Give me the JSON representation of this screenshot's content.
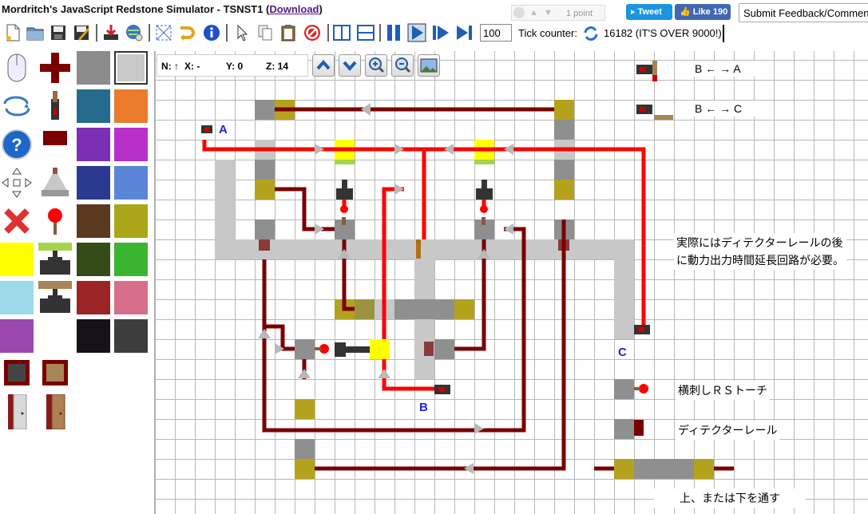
{
  "app": {
    "title_prefix": "Mordritch's JavaScript Redstone Simulator - TSNST1 (",
    "download_label": "Download",
    "title_suffix": ")"
  },
  "social": {
    "reddit_points": "1 point",
    "tweet_label": "Tweet",
    "like_label": "Like 190",
    "feedback_label": "Submit Feedback/Comments"
  },
  "toolbar": {
    "tick_rate": "100",
    "tick_counter_label": "Tick counter:",
    "tick_counter_value": "16182 (IT'S OVER 9000!)",
    "buttons": [
      "new",
      "open",
      "save",
      "save-as",
      "export",
      "share",
      "select-area",
      "rotate",
      "info",
      "pointer",
      "copy",
      "paste",
      "clear",
      "single-view",
      "split-view",
      "pause",
      "play",
      "step",
      "fast-forward"
    ]
  },
  "view": {
    "facing": "N: ↑",
    "x": "X: -",
    "y": "Y: 0",
    "z": "Z: 14"
  },
  "palette": {
    "colors": [
      "#8c8c8c",
      "#c9c9c9",
      "#246b8d",
      "#ea7c2c",
      "#7a2fb5",
      "#b930c8",
      "#2b3a90",
      "#5b86d7",
      "#5b3a1f",
      "#aba51a",
      "#344d18",
      "#3ab52f",
      "#9b2525",
      "#d66f8a",
      "#ffff00",
      "#9cd9e9",
      "#15121a",
      "#3d3d3d",
      "#9b47b0"
    ]
  },
  "annotations": {
    "label_a": "A",
    "label_b": "B",
    "label_c": "C",
    "legend_ba": "B ← → A",
    "legend_bc": "B ← → C",
    "note_line1": "実際にはディテクターレールの後",
    "note_line2": "に動力出力時間延長回路が必要。",
    "legend_torch": "横刺しＲＳトーチ",
    "legend_rail": "ディテクターレール",
    "legend_pass": "上、または下を通す"
  },
  "colors": {
    "redstone_on": "#ff0000",
    "redstone_off": "#7a0000",
    "stone": "#8f8f8f",
    "rail": "#c8c8c8",
    "lamp": "#ffff00",
    "piston_head": "#b5a21c",
    "accent": "#1e67c8"
  }
}
